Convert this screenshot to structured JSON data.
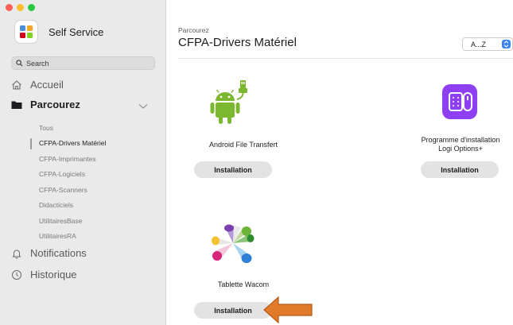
{
  "window": {
    "controls": [
      "close",
      "minimize",
      "zoom"
    ]
  },
  "sidebar": {
    "app_title": "Self Service",
    "search": {
      "placeholder": "Search",
      "value": ""
    },
    "nav": {
      "accueil": {
        "label": "Accueil",
        "icon": "home-icon"
      },
      "parcourez": {
        "label": "Parcourez",
        "icon": "folder-icon",
        "expanded": true
      },
      "notifications": {
        "label": "Notifications",
        "icon": "bell-icon"
      },
      "historique": {
        "label": "Historique",
        "icon": "clock-icon"
      }
    },
    "categories": [
      {
        "label": "Tous",
        "active": false
      },
      {
        "label": "CFPA-Drivers Matériel",
        "active": true
      },
      {
        "label": "CFPA-Imprimantes",
        "active": false
      },
      {
        "label": "CFPA-Logiciels",
        "active": false
      },
      {
        "label": "CFPA-Scanners",
        "active": false
      },
      {
        "label": "Didacticiels",
        "active": false
      },
      {
        "label": "UtilitairesBase",
        "active": false
      },
      {
        "label": "UtilitairesRA",
        "active": false
      }
    ]
  },
  "main": {
    "breadcrumb": "Parcourez",
    "title": "CFPA-Drivers Matériel",
    "sort": {
      "selected": "A...Z"
    },
    "items": [
      {
        "name": "Android File Transfert",
        "button": "Installation",
        "icon": "android-icon"
      },
      {
        "name_line1": "Programme d'installation",
        "name_line2": "Logi Options+",
        "button": "Installation",
        "icon": "logi-options-icon"
      },
      {
        "name": "Tablette Wacom",
        "button": "Installation",
        "icon": "wacom-icon"
      }
    ]
  },
  "colors": {
    "sidebar_bg": "#eaeaea",
    "android_green": "#7cb82f",
    "logi_purple": "#8e3ff2",
    "annotation_arrow": "#e07b2c"
  }
}
